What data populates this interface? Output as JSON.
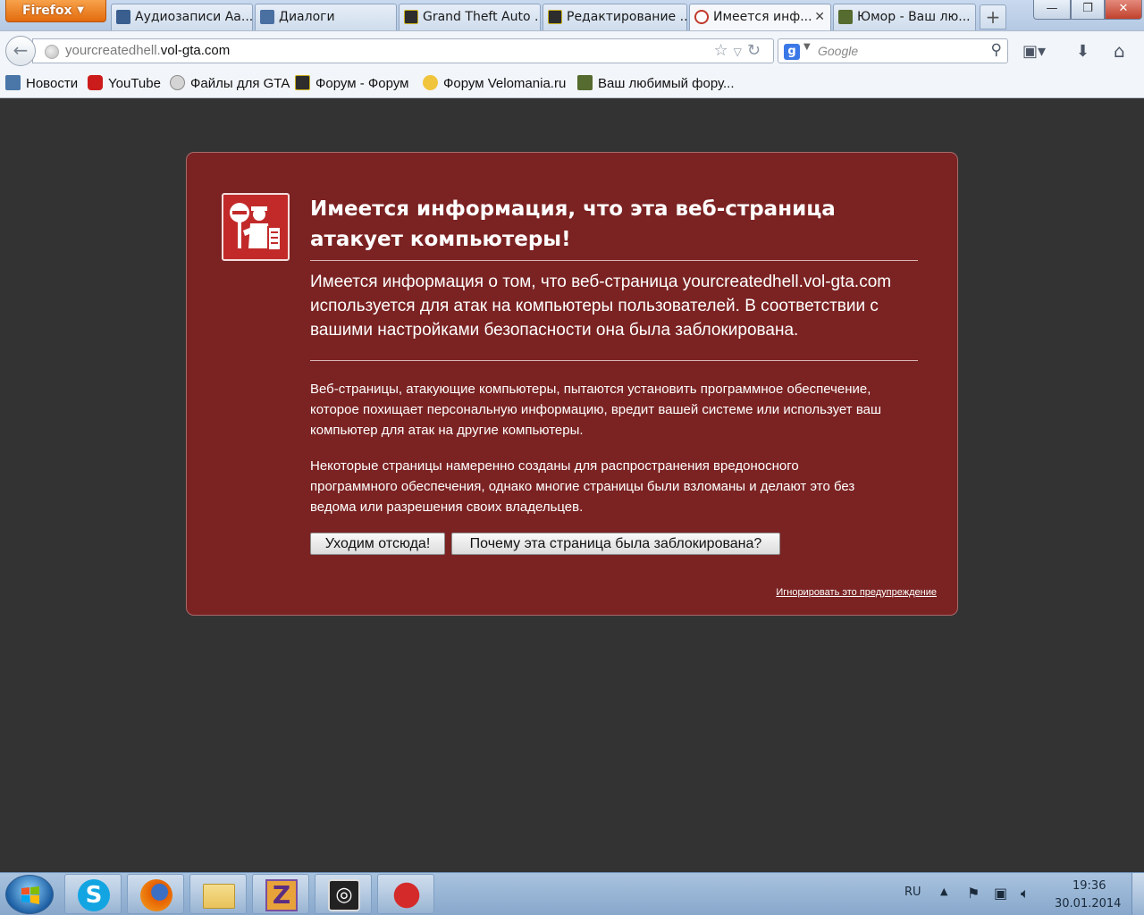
{
  "browser": {
    "menu_button": "Firefox",
    "tabs": [
      {
        "label": "Аудиозаписи Аа...",
        "icon": "play-icon",
        "color": "#3a5f8f"
      },
      {
        "label": "Диалоги",
        "icon": "chat-icon",
        "color": "#4a6fa1"
      },
      {
        "label": "Grand Theft Auto ...",
        "icon": "gta-icon",
        "color": "#2d2d2d"
      },
      {
        "label": "Редактирование ...",
        "icon": "gta-icon",
        "color": "#2d2d2d"
      },
      {
        "label": "Имеется инф...",
        "icon": "stop-icon",
        "color": "#c0392b",
        "active": true
      },
      {
        "label": "Юмор - Ваш лю...",
        "icon": "gta5-icon",
        "color": "#556b2f"
      }
    ],
    "new_tab": "+",
    "window_controls": {
      "minimize": "—",
      "maximize": "❐",
      "close": "✕"
    }
  },
  "navbar": {
    "url_prefix": "yourcreatedhell.",
    "url_domain": "vol-gta.com",
    "search_placeholder": "Google",
    "search_engine_letter": "g"
  },
  "bookmarks": [
    {
      "label": "Новости",
      "icon": "vk-icon",
      "color": "#4a76a8"
    },
    {
      "label": "YouTube",
      "icon": "youtube-icon",
      "color": "#cc1b1b"
    },
    {
      "label": "Файлы для GTA",
      "icon": "globe-icon",
      "color": "#8a8a8a"
    },
    {
      "label": "Форум - Форум",
      "icon": "gta-icon",
      "color": "#2d2d2d"
    },
    {
      "label": "Форум Velomania.ru",
      "icon": "velomania-icon",
      "color": "#f0c43c"
    },
    {
      "label": "Ваш любимый фору...",
      "icon": "gta5-icon",
      "color": "#556b2f"
    }
  ],
  "error_page": {
    "title": "Имеется информация, что эта веб-страница атакует компьютеры!",
    "short_desc": "Имеется информация о том, что веб-страница yourcreatedhell.vol-gta.com используется для атак на компьютеры пользователей. В соответствии с вашими настройками безопасности она была заблокирована.",
    "para1": "Веб-страницы, атакующие компьютеры, пытаются установить программное обеспечение, которое похищает персональную информацию, вредит вашей системе или использует ваш компьютер для атак на другие компьютеры.",
    "para2": "Некоторые страницы намеренно созданы для распространения вредоносного программного обеспечения, однако многие страницы были взломаны и делают это без ведома или разрешения своих владельцев.",
    "btn_leave": "Уходим отсюда!",
    "btn_why": "Почему эта страница была заблокирована?",
    "ignore_link": "Игнорировать это предупреждение",
    "box_color": "#7b2222"
  },
  "taskbar": {
    "apps": [
      {
        "name": "skype-icon",
        "color": "#12a5e2"
      },
      {
        "name": "firefox-icon",
        "color": "#e66000"
      },
      {
        "name": "explorer-folder-icon",
        "color": "#e8c25a"
      },
      {
        "name": "z-app-icon",
        "color": "#e8a23a"
      },
      {
        "name": "3ds-max-icon",
        "color": "#222222"
      },
      {
        "name": "red-splat-app-icon",
        "color": "#d42a2a"
      }
    ],
    "language": "RU",
    "time": "19:36",
    "date": "30.01.2014"
  }
}
